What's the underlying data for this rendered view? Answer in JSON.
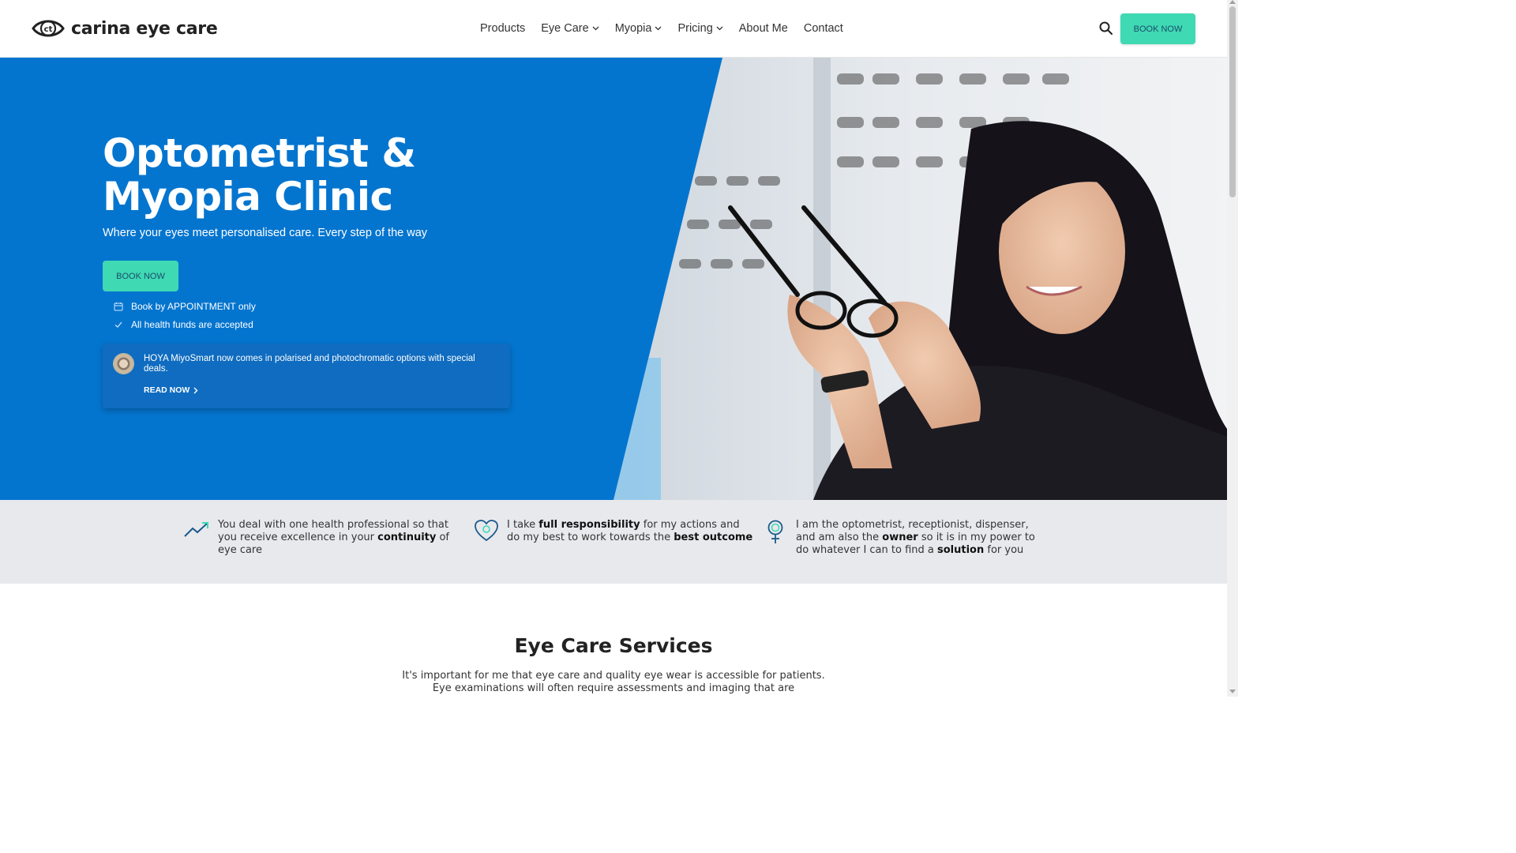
{
  "header": {
    "brand": "carina eye care",
    "nav": [
      {
        "label": "Products",
        "dropdown": false
      },
      {
        "label": "Eye Care",
        "dropdown": true
      },
      {
        "label": "Myopia",
        "dropdown": true
      },
      {
        "label": "Pricing",
        "dropdown": true
      },
      {
        "label": "About Me",
        "dropdown": false
      },
      {
        "label": "Contact",
        "dropdown": false
      }
    ],
    "search_icon": "search-icon",
    "book_label": "BOOK NOW"
  },
  "hero": {
    "title_line1": "Optometrist &",
    "title_line2": "Myopia Clinic",
    "subtitle": "Where your eyes meet personalised care. Every step of the way",
    "book_label": "BOOK NOW",
    "features": [
      {
        "icon": "calendar-icon",
        "text": "Book by APPOINTMENT only"
      },
      {
        "icon": "check-icon",
        "text": "All health funds are accepted"
      }
    ],
    "promo": {
      "text": "HOYA MiyoSmart now comes in polarised and photochromatic options with special deals.",
      "link_label": "READ NOW"
    }
  },
  "values": [
    {
      "icon": "trending-up-icon",
      "pre": "You deal with one health professional so that you receive excellence in your ",
      "bold": "continuity",
      "post": " of eye care"
    },
    {
      "icon": "heart-icon",
      "pre": "I take ",
      "bold": "full responsibility",
      "mid": " for my actions and do my best to work towards the ",
      "bold2": "best outcome",
      "post": ""
    },
    {
      "icon": "female-icon",
      "pre": "I am the optometrist, receptionist, dispenser, and am also the ",
      "bold": "owner",
      "mid": " so it is in my power to do whatever I can to find a ",
      "bold2": "solution",
      "post": " for you"
    }
  ],
  "services": {
    "title": "Eye Care Services",
    "desc_line1": "It's important for me that eye care and quality eye wear is accessible for patients.",
    "desc_line2": "Eye examinations will often require assessments and imaging that are"
  },
  "colors": {
    "hero_blue": "#0475cf",
    "accent_teal": "#3fd9b3",
    "strip_gray": "#e8e9ed"
  }
}
